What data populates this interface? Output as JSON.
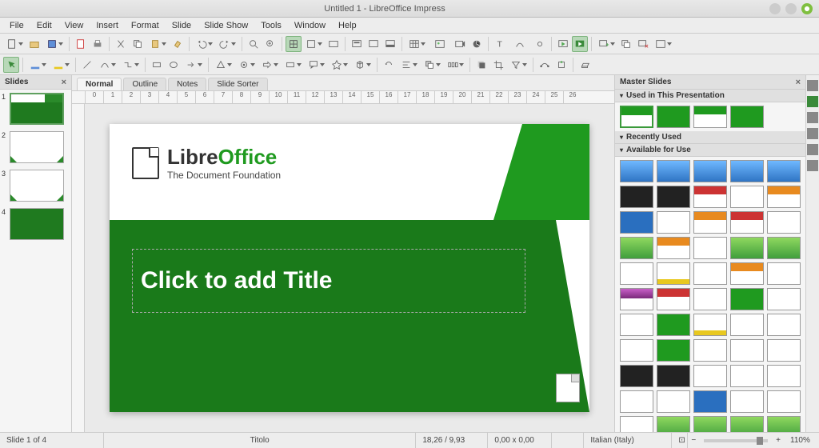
{
  "titlebar": {
    "title": "Untitled 1 - LibreOffice Impress"
  },
  "menus": [
    "File",
    "Edit",
    "View",
    "Insert",
    "Format",
    "Slide",
    "Slide Show",
    "Tools",
    "Window",
    "Help"
  ],
  "panels": {
    "slides": {
      "title": "Slides"
    },
    "master": {
      "title": "Master Slides",
      "sections": {
        "used": "Used in This Presentation",
        "recent": "Recently Used",
        "available": "Available for Use"
      }
    }
  },
  "view_tabs": [
    "Normal",
    "Outline",
    "Notes",
    "Slide Sorter"
  ],
  "slide": {
    "logo_line1_a": "Libre",
    "logo_line1_b": "Office",
    "logo_line2": "The Document Foundation",
    "title_placeholder": "Click to add Title"
  },
  "ruler_ticks": [
    "0",
    "1",
    "2",
    "3",
    "4",
    "5",
    "6",
    "7",
    "8",
    "9",
    "10",
    "11",
    "12",
    "13",
    "14",
    "15",
    "16",
    "17",
    "18",
    "19",
    "20",
    "21",
    "22",
    "23",
    "24",
    "25",
    "26"
  ],
  "slide_thumbs": [
    1,
    2,
    3,
    4
  ],
  "status": {
    "slide_pos": "Slide 1 of 4",
    "obj": "Titolo",
    "coords": "18,26 / 9,93",
    "size": "0,00 x 0,00",
    "lang": "Italian (Italy)",
    "zoom": "110%"
  },
  "master_templates": {
    "used": [
      "t-green",
      "t-greenfull",
      "t-green",
      "t-greenfull"
    ],
    "available": [
      "t-blue",
      "t-blue",
      "t-blue",
      "t-blue",
      "t-blue",
      "t-dark",
      "t-dark",
      "t-red",
      "",
      "t-orange",
      "t-bluefull",
      "",
      "t-orange",
      "t-red",
      "",
      "t-greenlime",
      "t-orange",
      "",
      "t-greenlime",
      "t-greenlime",
      "",
      "t-yellow",
      "",
      "t-orange",
      "",
      "t-purple",
      "t-red",
      "",
      "t-greenfull",
      "",
      "",
      "t-greenfull",
      "t-yellow",
      "",
      "",
      "",
      "t-greenfull",
      "",
      "",
      "",
      "t-dark",
      "t-dark",
      "",
      "",
      "",
      "",
      "",
      "t-bluefull",
      "",
      "",
      "",
      "t-greenlime",
      "t-greenlime",
      "t-greenlime",
      "t-greenlime"
    ]
  }
}
